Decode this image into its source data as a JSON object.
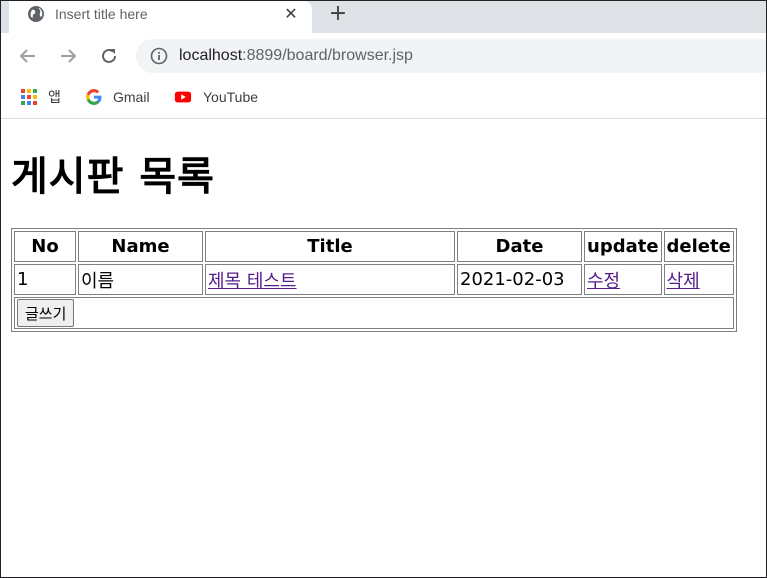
{
  "browser": {
    "tab_title": "Insert title here",
    "url_host": "localhost",
    "url_rest": ":8899/board/browser.jsp",
    "bookmarks": [
      {
        "label": "앱",
        "icon": "apps-grid-icon"
      },
      {
        "label": "Gmail",
        "icon": "google-g-icon"
      },
      {
        "label": "YouTube",
        "icon": "youtube-icon"
      }
    ]
  },
  "page": {
    "title": "게시판 목록",
    "table": {
      "headers": [
        "No",
        "Name",
        "Title",
        "Date",
        "update",
        "delete"
      ],
      "rows": [
        {
          "no": "1",
          "name": "이름",
          "title": "제목 테스트",
          "date": "2021-02-03",
          "update": "수정",
          "delete": "삭제"
        }
      ]
    },
    "write_button": "글쓰기"
  },
  "colors": {
    "link_visited": "#551a8b",
    "youtube_red": "#ff0000",
    "tabstrip": "#dee1e6",
    "omnibox": "#f1f3f4"
  }
}
